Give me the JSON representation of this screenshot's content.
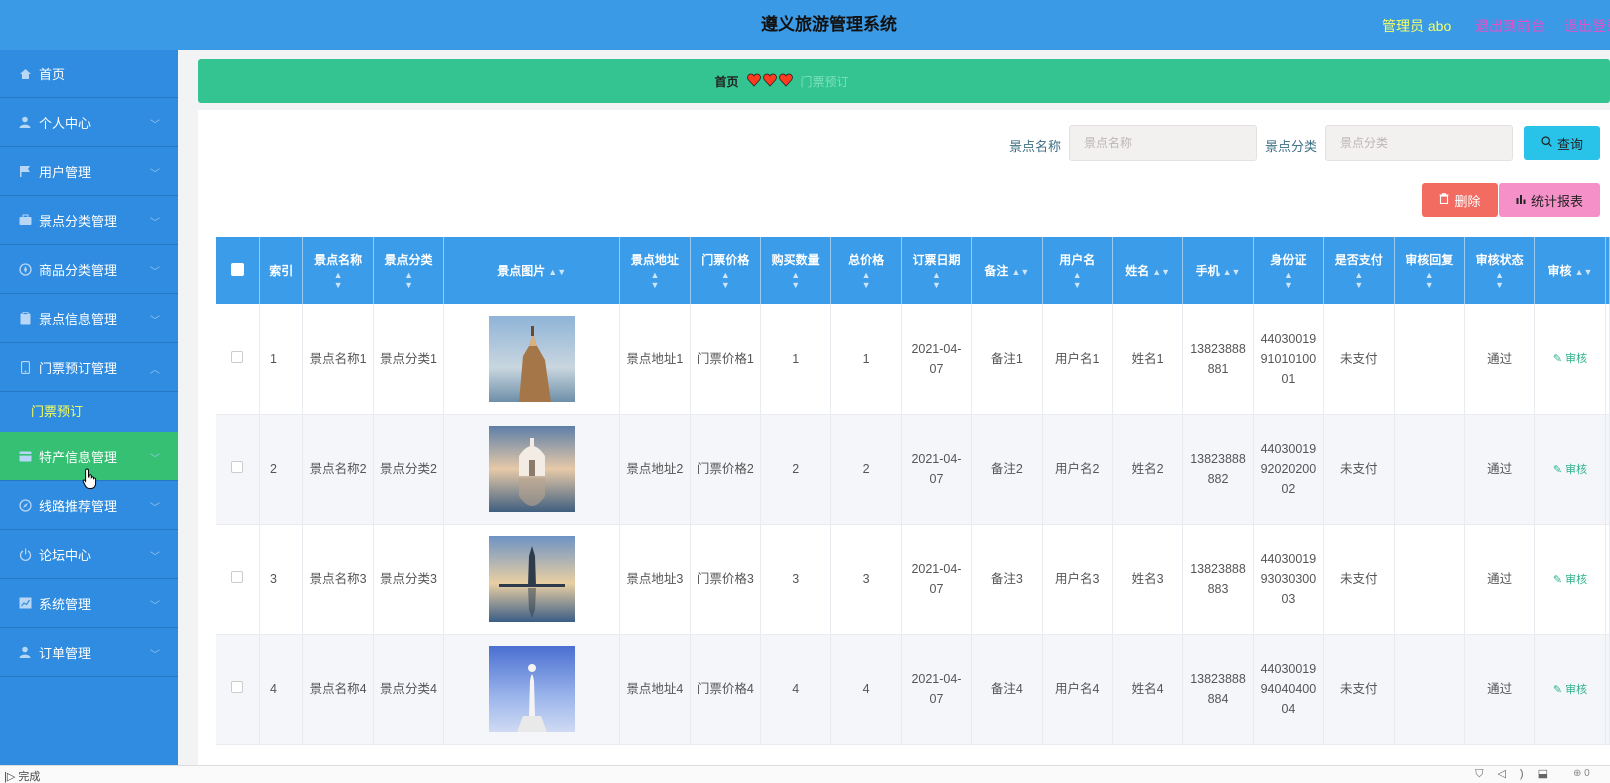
{
  "header": {
    "title": "遵义旅游管理系统",
    "admin_label": "管理员 abo",
    "front_link": "退出到前台",
    "logout_link": "退出登录"
  },
  "sidebar": {
    "items": [
      {
        "label": "首页",
        "icon": "home-icon"
      },
      {
        "label": "个人中心",
        "icon": "user-icon"
      },
      {
        "label": "用户管理",
        "icon": "flag-icon"
      },
      {
        "label": "景点分类管理",
        "icon": "briefcase-icon"
      },
      {
        "label": "商品分类管理",
        "icon": "compass-icon"
      },
      {
        "label": "景点信息管理",
        "icon": "clipboard-icon"
      },
      {
        "label": "门票预订管理",
        "icon": "phone-icon"
      },
      {
        "label": "特产信息管理",
        "icon": "card-icon"
      },
      {
        "label": "线路推荐管理",
        "icon": "compass-icon"
      },
      {
        "label": "论坛中心",
        "icon": "power-icon"
      },
      {
        "label": "系统管理",
        "icon": "chart-icon"
      },
      {
        "label": "订单管理",
        "icon": "user-icon"
      }
    ],
    "submenu_label": "门票预订"
  },
  "breadcrumb": {
    "home": "首页",
    "current": "门票预订"
  },
  "search": {
    "name_label": "景点名称",
    "name_placeholder": "景点名称",
    "category_label": "景点分类",
    "category_placeholder": "景点分类",
    "query_button": "查询"
  },
  "actions": {
    "delete_button": "删除",
    "report_button": "统计报表"
  },
  "table": {
    "headers": [
      "索引",
      "景点名称",
      "景点分类",
      "景点图片",
      "景点地址",
      "门票价格",
      "购买数量",
      "总价格",
      "订票日期",
      "备注",
      "用户名",
      "姓名",
      "手机",
      "身份证",
      "是否支付",
      "审核回复",
      "审核状态",
      "审核"
    ],
    "rows": [
      {
        "index": "1",
        "name": "景点名称1",
        "category": "景点分类1",
        "address": "景点地址1",
        "price": "门票价格1",
        "qty": "1",
        "total": "1",
        "date": "2021-04-07",
        "remark": "备注1",
        "username": "用户名1",
        "realname": "姓名1",
        "phone": "13823888881",
        "idcard": "440300199101010001",
        "paid": "未支付",
        "reply": "",
        "status": "通过",
        "audit": "审核"
      },
      {
        "index": "2",
        "name": "景点名称2",
        "category": "景点分类2",
        "address": "景点地址2",
        "price": "门票价格2",
        "qty": "2",
        "total": "2",
        "date": "2021-04-07",
        "remark": "备注2",
        "username": "用户名2",
        "realname": "姓名2",
        "phone": "13823888882",
        "idcard": "440300199202020002",
        "paid": "未支付",
        "reply": "",
        "status": "通过",
        "audit": "审核"
      },
      {
        "index": "3",
        "name": "景点名称3",
        "category": "景点分类3",
        "address": "景点地址3",
        "price": "门票价格3",
        "qty": "3",
        "total": "3",
        "date": "2021-04-07",
        "remark": "备注3",
        "username": "用户名3",
        "realname": "姓名3",
        "phone": "13823888883",
        "idcard": "440300199303030003",
        "paid": "未支付",
        "reply": "",
        "status": "通过",
        "audit": "审核"
      },
      {
        "index": "4",
        "name": "景点名称4",
        "category": "景点分类4",
        "address": "景点地址4",
        "price": "门票价格4",
        "qty": "4",
        "total": "4",
        "date": "2021-04-07",
        "remark": "备注4",
        "username": "用户名4",
        "realname": "姓名4",
        "phone": "13823888884",
        "idcard": "440300199404040004",
        "paid": "未支付",
        "reply": "",
        "status": "通过",
        "audit": "审核"
      }
    ]
  },
  "statusbar": {
    "text": "完成",
    "zoom": "0"
  },
  "colors": {
    "header_bg": "#3a9ae6",
    "sidebar_bg": "#2f8ce0",
    "sidebar_active": "#35c074",
    "breadcrumb_bg": "#33c491",
    "table_header": "#3b9cea",
    "accent_yellow": "#f4ff6a",
    "accent_pink": "#e64fc8"
  }
}
